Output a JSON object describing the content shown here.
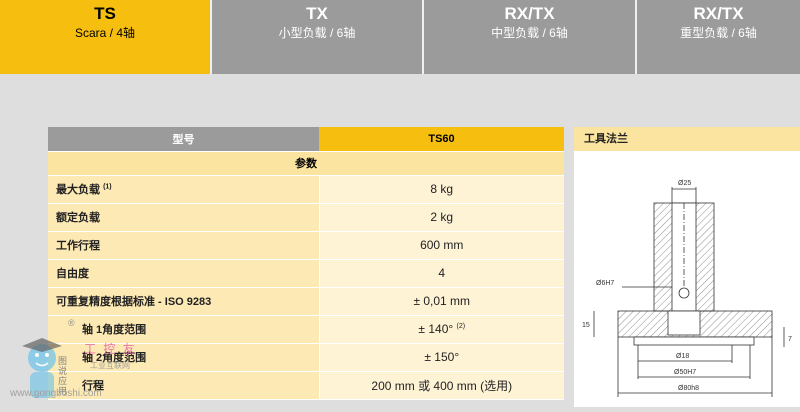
{
  "tabs": [
    {
      "title": "TS",
      "subtitle": "Scara / 4轴",
      "active": true
    },
    {
      "title": "TX",
      "subtitle": "小型负载 / 6轴",
      "active": false
    },
    {
      "title": "RX/TX",
      "subtitle": "中型负载 / 6轴",
      "active": false
    },
    {
      "title": "RX/TX",
      "subtitle": "重型负载 / 6轴",
      "active": false
    }
  ],
  "spec_table": {
    "header_label": "型号",
    "header_model": "TS60",
    "group_label": "参数",
    "rows": [
      {
        "label": "最大负载",
        "note": "(1)",
        "value": "8 kg",
        "value_note": ""
      },
      {
        "label": "额定负载",
        "note": "",
        "value": "2 kg",
        "value_note": ""
      },
      {
        "label": "工作行程",
        "note": "",
        "value": "600 mm",
        "value_note": ""
      },
      {
        "label": "自由度",
        "note": "",
        "value": "4",
        "value_note": ""
      },
      {
        "label": "可重复精度根据标准 - ISO 9283",
        "note": "",
        "value": "± 0,01 mm",
        "value_note": ""
      },
      {
        "label": "轴 1角度范围",
        "note": "",
        "value": "± 140°",
        "value_note": "(2)"
      },
      {
        "label": "轴 2角度范围",
        "note": "",
        "value": "± 150°",
        "value_note": ""
      },
      {
        "label": "行程",
        "note": "",
        "value": "200 mm 或 400 mm (选用)",
        "value_note": ""
      }
    ]
  },
  "flange": {
    "title": "工具法兰",
    "dims": {
      "d25": "Ø25",
      "d6h7": "Ø6H7",
      "d18": "Ø18",
      "d50h7": "Ø50H7",
      "d80h8": "Ø80h8",
      "h15": "15",
      "h7": "7"
    }
  },
  "watermark": {
    "text": "工 控 友",
    "url": "www.gongboshi.com",
    "side_text": "图 说 应 用",
    "sub": "工业互联网",
    "registered": "®"
  },
  "colors": {
    "accent": "#f6bf10",
    "inactive": "#9b9b9b",
    "label_bg": "#fde9b4",
    "value_bg": "#fff3d6"
  }
}
